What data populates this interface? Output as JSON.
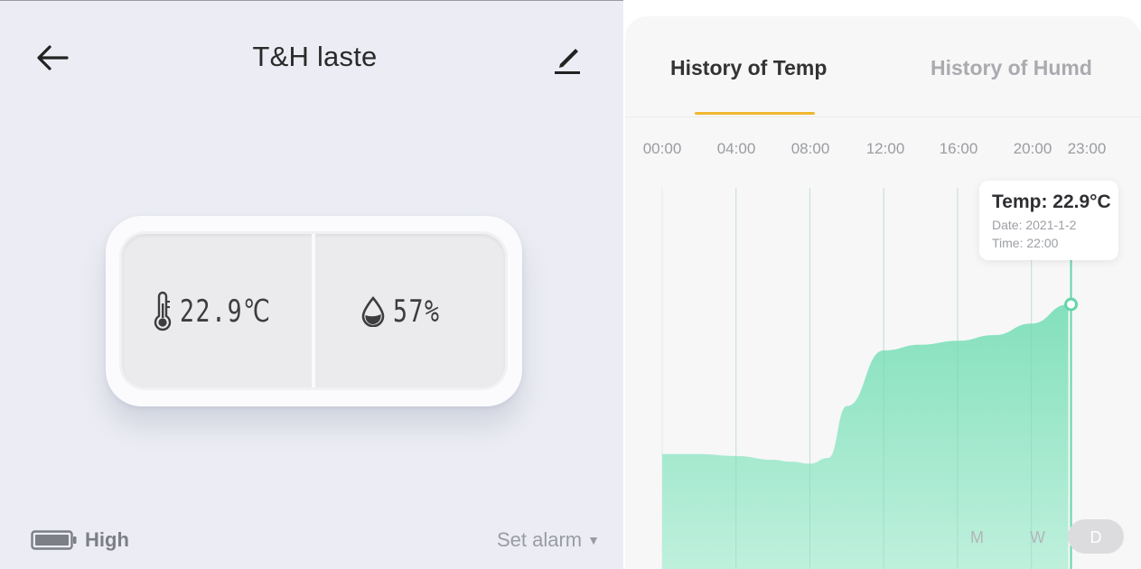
{
  "header": {
    "title": "T&H laste"
  },
  "device": {
    "temperature": "22.9℃",
    "humidity": "57%"
  },
  "footer": {
    "battery_label": "High",
    "alarm_label": "Set alarm"
  },
  "history": {
    "tabs": [
      {
        "label": "History of Temp",
        "active": true
      },
      {
        "label": "History of Humd",
        "active": false
      }
    ],
    "time_labels": [
      "00:00",
      "04:00",
      "08:00",
      "12:00",
      "16:00",
      "20:00",
      "23:00"
    ],
    "tooltip": {
      "title": "Temp: 22.9°C",
      "date": "Date: 2021-1-2",
      "time": "Time: 22:00"
    },
    "range_options": [
      {
        "label": "M",
        "selected": false
      },
      {
        "label": "W",
        "selected": false
      },
      {
        "label": "D",
        "selected": true
      }
    ]
  },
  "chart_data": {
    "type": "area",
    "x": [
      "00:00",
      "02:00",
      "04:00",
      "06:00",
      "07:00",
      "08:00",
      "09:00",
      "10:00",
      "12:00",
      "14:00",
      "16:00",
      "18:00",
      "20:00",
      "22:00"
    ],
    "values": [
      22.12,
      22.12,
      22.11,
      22.09,
      22.08,
      22.07,
      22.1,
      22.37,
      22.66,
      22.69,
      22.71,
      22.74,
      22.8,
      22.9
    ],
    "x_ticks": [
      "00:00",
      "04:00",
      "08:00",
      "12:00",
      "16:00",
      "20:00",
      "23:00"
    ],
    "highlight": {
      "x": "22:00",
      "value": 22.9
    },
    "colors": {
      "fill_top": "#83e0bd",
      "fill_bottom": "#bff0dd",
      "line": "#63d6a9",
      "accent": "#f0b72f"
    }
  }
}
